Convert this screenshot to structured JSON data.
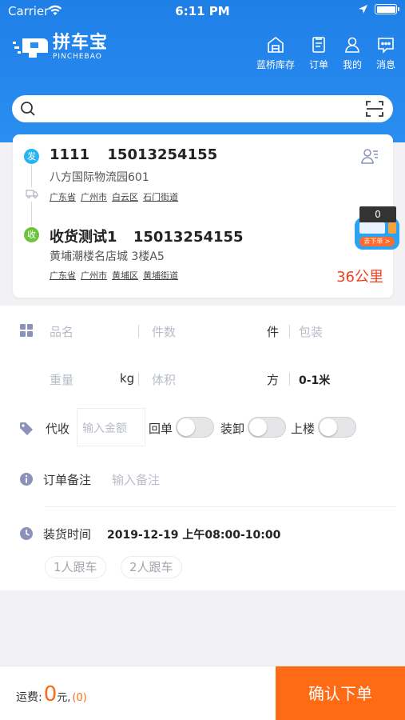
{
  "status_bar": {
    "carrier": "Carrier",
    "time": "6:11 PM"
  },
  "brand": {
    "name_cn": "拼车宝",
    "name_en": "PINCHEBAO"
  },
  "nav": {
    "inventory": "蓝桥库存",
    "orders": "订单",
    "mine": "我的",
    "messages": "消息"
  },
  "search": {
    "placeholder": ""
  },
  "sender": {
    "badge": "发",
    "name": "1111",
    "phone": "15013254155",
    "detail": "八方国际物流园601",
    "region": [
      "广东省",
      "广州市",
      "白云区",
      "石门街道"
    ]
  },
  "receiver": {
    "badge": "收",
    "name": "收货测试1",
    "phone": "15013254155",
    "detail": "黄埔潮楼名店城 3楼A5",
    "region": [
      "广东省",
      "广州市",
      "黄埔区",
      "黄埔街道"
    ]
  },
  "distance": "36公里",
  "promo": {
    "count": "0",
    "button": "去下单 >"
  },
  "form": {
    "goods_name_placeholder": "品名",
    "pieces_placeholder": "件数",
    "pieces_unit": "件",
    "packing_placeholder": "包装",
    "weight_placeholder": "重量",
    "weight_unit": "kg",
    "volume_placeholder": "体积",
    "volume_unit": "方",
    "length": "0-1米",
    "cod_label": "代收",
    "amount_placeholder": "输入金额",
    "receipt_label": "回单",
    "loading_label": "装卸",
    "upstairs_label": "上楼",
    "remark_label": "订单备注",
    "remark_placeholder": "输入备注",
    "loading_time_label": "装货时间",
    "loading_time_value": "2019-12-19 上午08:00-10:00",
    "chip_one": "1人跟车",
    "chip_two": "2人跟车"
  },
  "footer": {
    "fee_label": "运费:",
    "fee_value": "0",
    "fee_unit": "元,",
    "fee_extra": "(0)",
    "confirm": "确认下单"
  }
}
